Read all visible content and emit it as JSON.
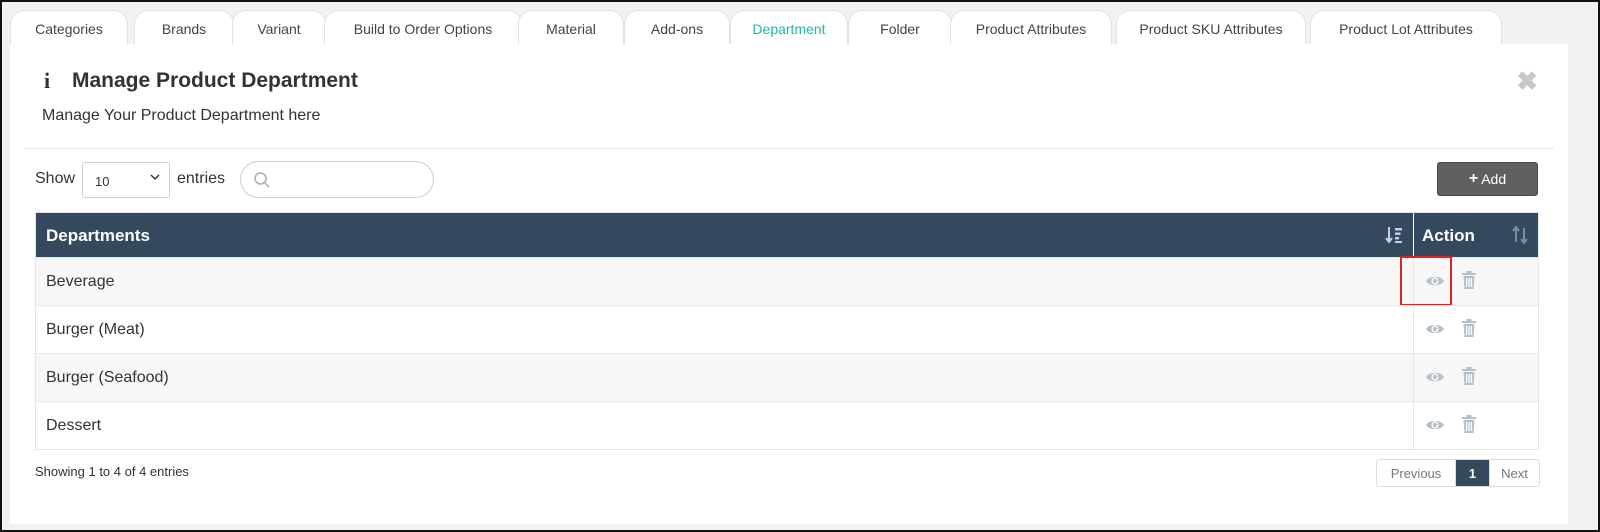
{
  "tabs": [
    {
      "label": "Categories"
    },
    {
      "label": "Brands"
    },
    {
      "label": "Variant"
    },
    {
      "label": "Build to Order Options"
    },
    {
      "label": "Material"
    },
    {
      "label": "Add-ons"
    },
    {
      "label": "Department",
      "active": true
    },
    {
      "label": "Folder"
    },
    {
      "label": "Product Attributes"
    },
    {
      "label": "Product SKU Attributes"
    },
    {
      "label": "Product Lot Attributes"
    }
  ],
  "header": {
    "title": "Manage Product Department",
    "subtitle": "Manage Your Product Department here"
  },
  "controls": {
    "show_label": "Show",
    "entries_value": "10",
    "entries_label": "entries",
    "search_value": "",
    "add_label": "Add"
  },
  "table": {
    "columns": [
      "Departments",
      "Action"
    ],
    "rows": [
      {
        "name": "Beverage"
      },
      {
        "name": "Burger (Meat)"
      },
      {
        "name": "Burger (Seafood)"
      },
      {
        "name": "Dessert"
      }
    ]
  },
  "footer": {
    "showing": "Showing 1 to 4 of 4 entries",
    "previous": "Previous",
    "current_page": "1",
    "next": "Next"
  },
  "colors": {
    "active_tab": "#1abc9c",
    "table_header": "#34495e",
    "add_button": "#5f5f5f",
    "highlight": "#e02020"
  }
}
